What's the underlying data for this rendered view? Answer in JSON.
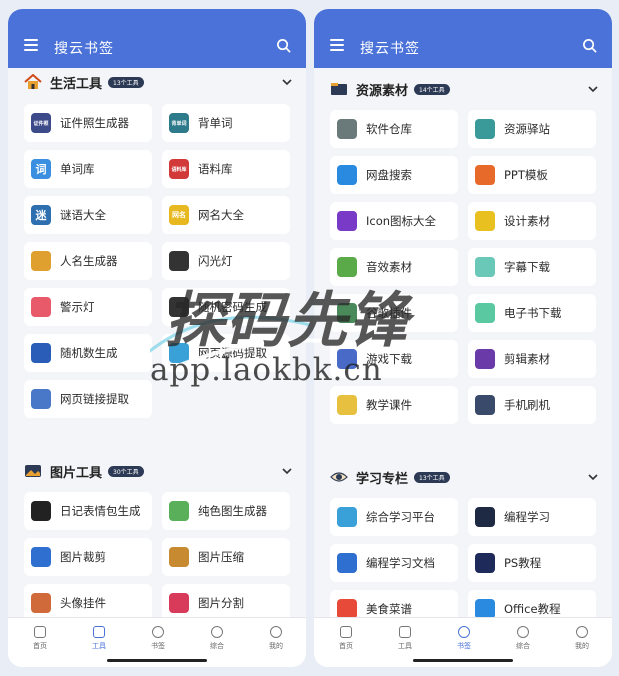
{
  "screens": [
    {
      "title": "搜云书签",
      "sections": [
        {
          "title": "生活工具",
          "badge": "13个工具",
          "items": [
            {
              "label": "证件照生成器",
              "icon": "id-photo-icon",
              "color": "#3d4a8a",
              "tag": "证件照"
            },
            {
              "label": "背单词",
              "icon": "word-book-icon",
              "color": "#2c7a8a",
              "tag": "背单词"
            },
            {
              "label": "单词库",
              "icon": "dictionary-icon",
              "color": "#3b8fe0",
              "tag": "词"
            },
            {
              "label": "语料库",
              "icon": "corpus-icon",
              "color": "#d23a3a",
              "tag": "语料库"
            },
            {
              "label": "谜语大全",
              "icon": "riddle-icon",
              "color": "#2e6fb0",
              "tag": "迷"
            },
            {
              "label": "网名大全",
              "icon": "nickname-icon",
              "color": "#e8b820",
              "tag": "网名"
            },
            {
              "label": "人名生成器",
              "icon": "name-generator-icon",
              "color": "#e0a030",
              "tag": ""
            },
            {
              "label": "闪光灯",
              "icon": "flashlight-icon",
              "color": "#333333",
              "tag": ""
            },
            {
              "label": "警示灯",
              "icon": "warning-light-icon",
              "color": "#e85a6a",
              "tag": ""
            },
            {
              "label": "随机密码生成",
              "icon": "password-icon",
              "color": "#333333",
              "tag": ""
            },
            {
              "label": "随机数生成",
              "icon": "random-number-icon",
              "color": "#2a5db8",
              "tag": ""
            },
            {
              "label": "网页源码提取",
              "icon": "source-code-icon",
              "color": "#3aa0d8",
              "tag": ""
            },
            {
              "label": "网页链接提取",
              "icon": "link-icon",
              "color": "#4a78c8",
              "tag": ""
            }
          ]
        },
        {
          "title": "图片工具",
          "badge": "30个工具",
          "items": [
            {
              "label": "日记表情包生成",
              "icon": "panda-icon",
              "color": "#222222",
              "tag": ""
            },
            {
              "label": "纯色图生成器",
              "icon": "color-palette-icon",
              "color": "#5ab05a",
              "tag": ""
            },
            {
              "label": "图片裁剪",
              "icon": "crop-icon",
              "color": "#2e6fd0",
              "tag": ""
            },
            {
              "label": "图片压缩",
              "icon": "compress-icon",
              "color": "#c88a30",
              "tag": ""
            },
            {
              "label": "头像挂件",
              "icon": "avatar-frame-icon",
              "color": "#d06a3a",
              "tag": ""
            },
            {
              "label": "图片分割",
              "icon": "split-icon",
              "color": "#d83a5a",
              "tag": ""
            }
          ]
        }
      ],
      "tabs": [
        {
          "label": "首页",
          "icon": "home-icon"
        },
        {
          "label": "工具",
          "icon": "tools-icon"
        },
        {
          "label": "书签",
          "icon": "bookmark-icon"
        },
        {
          "label": "综合",
          "icon": "compass-icon"
        },
        {
          "label": "我的",
          "icon": "profile-icon"
        }
      ],
      "active_tab": 1
    },
    {
      "title": "搜云书签",
      "sections": [
        {
          "title": "资源素材",
          "badge": "14个工具",
          "items": [
            {
              "label": "软件仓库",
              "icon": "software-repo-icon",
              "color": "#6a7a7a",
              "tag": ""
            },
            {
              "label": "资源驿站",
              "icon": "resource-station-icon",
              "color": "#3a9a9a",
              "tag": ""
            },
            {
              "label": "网盘搜索",
              "icon": "cloud-search-icon",
              "color": "#2a8ae0",
              "tag": ""
            },
            {
              "label": "PPT模板",
              "icon": "ppt-icon",
              "color": "#e86a2a",
              "tag": ""
            },
            {
              "label": "Icon图标大全",
              "icon": "icon-library-icon",
              "color": "#7a3ac8",
              "tag": ""
            },
            {
              "label": "设计素材",
              "icon": "design-material-icon",
              "color": "#e8c020",
              "tag": ""
            },
            {
              "label": "音效素材",
              "icon": "sound-effect-icon",
              "color": "#5aaa4a",
              "tag": ""
            },
            {
              "label": "字幕下载",
              "icon": "subtitle-icon",
              "color": "#6ac8b8",
              "tag": ""
            },
            {
              "label": "谷歌插件",
              "icon": "chrome-plugin-icon",
              "color": "#4a8a5a",
              "tag": ""
            },
            {
              "label": "电子书下载",
              "icon": "ebook-icon",
              "color": "#5ac8a0",
              "tag": ""
            },
            {
              "label": "游戏下载",
              "icon": "game-icon",
              "color": "#4a6ac8",
              "tag": ""
            },
            {
              "label": "剪辑素材",
              "icon": "video-edit-icon",
              "color": "#6a3aa8",
              "tag": ""
            },
            {
              "label": "教学课件",
              "icon": "courseware-icon",
              "color": "#e8c040",
              "tag": ""
            },
            {
              "label": "手机刷机",
              "icon": "phone-flash-icon",
              "color": "#3a4a6a",
              "tag": ""
            }
          ]
        },
        {
          "title": "学习专栏",
          "badge": "13个工具",
          "items": [
            {
              "label": "综合学习平台",
              "icon": "study-platform-icon",
              "color": "#3aa0d8",
              "tag": ""
            },
            {
              "label": "编程学习",
              "icon": "coding-icon",
              "color": "#1e2a44",
              "tag": ""
            },
            {
              "label": "编程学习文档",
              "icon": "docs-icon",
              "color": "#2e6fd0",
              "tag": ""
            },
            {
              "label": "PS教程",
              "icon": "ps-icon",
              "color": "#1e2a5a",
              "tag": ""
            },
            {
              "label": "美食菜谱",
              "icon": "recipe-icon",
              "color": "#e84a3a",
              "tag": ""
            },
            {
              "label": "Office教程",
              "icon": "office-icon",
              "color": "#2a8ae0",
              "tag": ""
            }
          ]
        }
      ],
      "tabs": [
        {
          "label": "首页",
          "icon": "home-icon"
        },
        {
          "label": "工具",
          "icon": "tools-icon"
        },
        {
          "label": "书签",
          "icon": "bookmark-icon"
        },
        {
          "label": "综合",
          "icon": "compass-icon"
        },
        {
          "label": "我的",
          "icon": "profile-icon"
        }
      ],
      "active_tab": 2
    }
  ],
  "watermark": {
    "brand": "探码先锋",
    "url": "app.laokbk.cn"
  },
  "colors": {
    "appbar": "#4a72d8",
    "active_tab": "#4a72d8",
    "badge": "#2c3a55"
  }
}
